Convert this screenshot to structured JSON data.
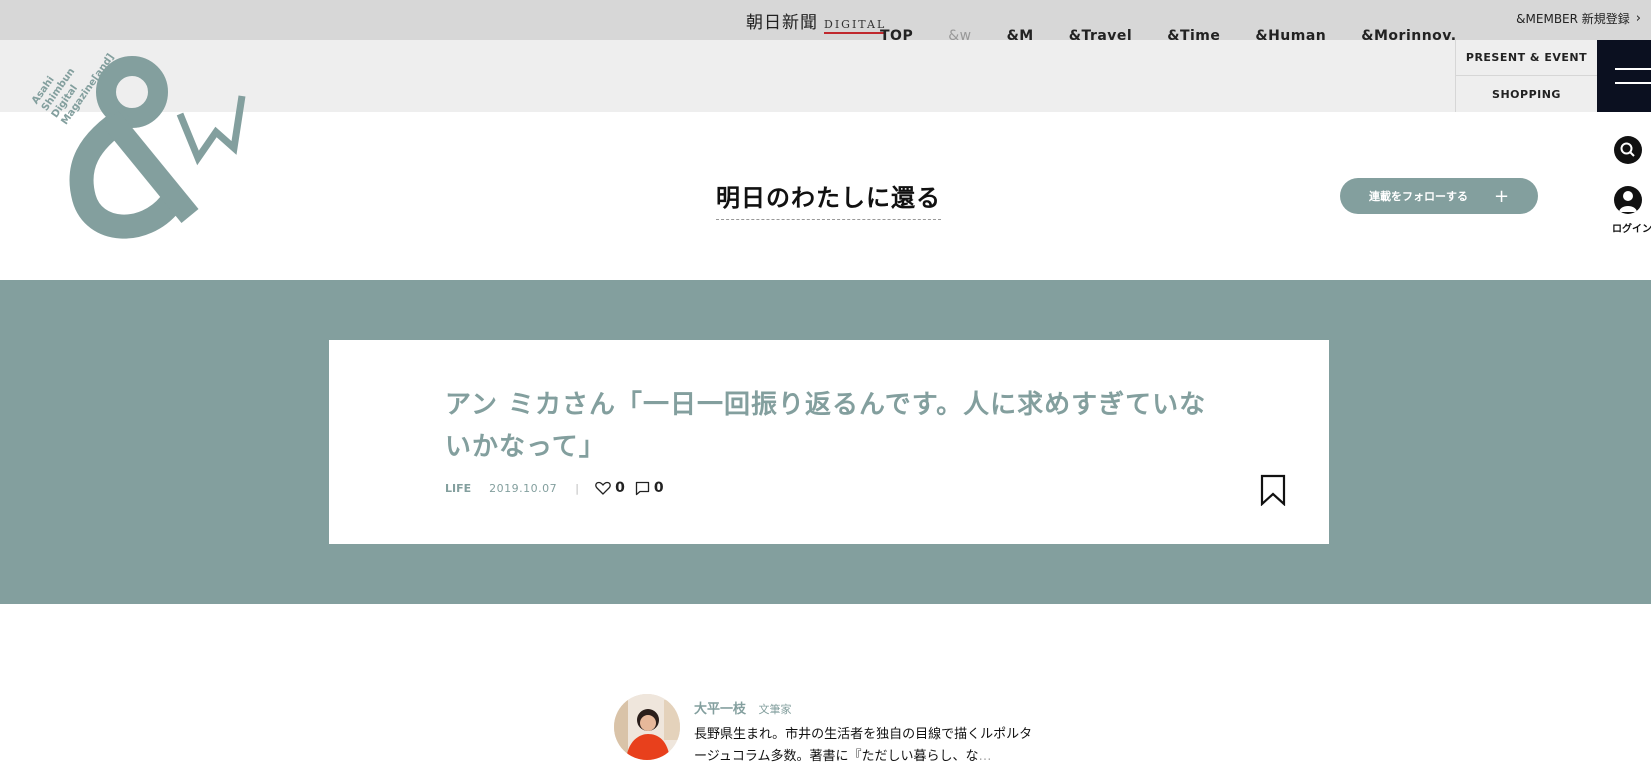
{
  "topbar": {
    "asahi_logo_jp": "朝日新聞",
    "asahi_logo_digital": "DIGITAL",
    "member_link": "&MEMBER 新規登録"
  },
  "nav": {
    "items": [
      {
        "label": "TOP"
      },
      {
        "label": "&w"
      },
      {
        "label": "&M"
      },
      {
        "label": "&Travel"
      },
      {
        "label": "&Time"
      },
      {
        "label": "&Human"
      },
      {
        "label": "&Morinnov."
      }
    ],
    "present_event": "PRESENT & EVENT",
    "shopping": "SHOPPING"
  },
  "logo": {
    "line1": "Asahi",
    "line2": "Shimbun",
    "line3": "Digital",
    "line4": "Magazine[and]"
  },
  "series": {
    "title": "明日のわたしに還る",
    "follow_label": "連載をフォローする",
    "follow_plus": "+"
  },
  "side": {
    "login_label": "ログイン"
  },
  "article": {
    "title": "アン ミカさん「一日一回振り返るんです。人に求めすぎていないかなって」",
    "category": "LIFE",
    "date": "2019.10.07",
    "separator": "|",
    "likes": "0",
    "comments": "0"
  },
  "author": {
    "name": "大平一枝",
    "role": "文筆家",
    "bio": "長野県生まれ。市井の生活者を独自の目線で描くルポルタージュコラム多数。著書に『ただしい暮らし、な",
    "bio_fade": "…"
  },
  "colors": {
    "accent": "#839f9e",
    "topbar": "#d7d7d7",
    "navbar": "#eeeeee",
    "menu": "#0b1020"
  }
}
